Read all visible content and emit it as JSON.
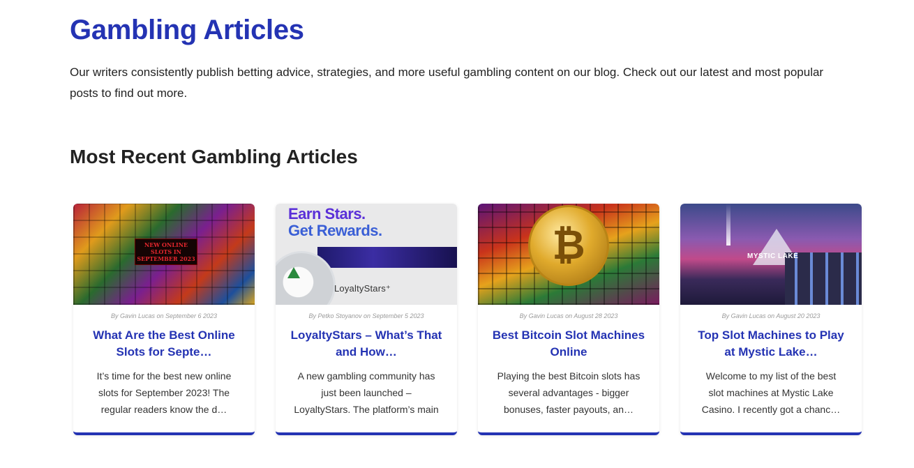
{
  "page": {
    "title": "Gambling Articles",
    "intro": "Our writers consistently publish betting advice, strategies, and more useful gambling content on our blog. Check out our latest and most popular posts to find out more.",
    "section_title": "Most Recent Gambling Articles"
  },
  "colors": {
    "accent": "#2433b3",
    "text": "#222222",
    "meta": "#9a9a9a"
  },
  "articles": [
    {
      "meta": "By Gavin Lucas on September 6 2023",
      "title": "What Are the Best Online Slots for Septe…",
      "excerpt": "It’s time for the best new online slots for September 2023! The regular readers know the d…",
      "image": {
        "badge": "NEW ONLINE SLOTS IN SEPTEMBER 2023"
      }
    },
    {
      "meta": "By Petko Stoyanov on September 5 2023",
      "title": "LoyaltyStars – What’s That and How…",
      "excerpt": "A new gambling community has just been launched – LoyaltyStars. The platform’s main scope …",
      "image": {
        "line1": "Earn Stars.",
        "line2": "Get Rewards.",
        "logo": "LoyaltyStars⁺"
      }
    },
    {
      "meta": "By Gavin Lucas on August 28 2023",
      "title": "Best Bitcoin Slot Machines Online",
      "excerpt": "Playing the best Bitcoin slots has several advantages - bigger bonuses, faster payouts, an…",
      "image": {
        "symbol": "₿"
      }
    },
    {
      "meta": "By Gavin Lucas on August 20 2023",
      "title": "Top Slot Machines to Play at Mystic Lake…",
      "excerpt": "Welcome to my list of the best slot machines at Mystic Lake Casino. I recently got a chanc…",
      "image": {
        "logo": "MYSTIC LAKE"
      }
    }
  ]
}
